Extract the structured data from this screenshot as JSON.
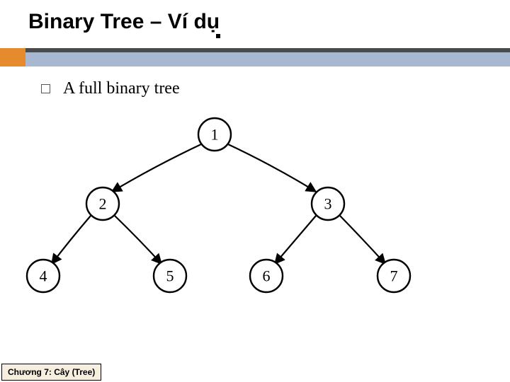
{
  "title": "Binary Tree – Ví dụ",
  "bullet": "A full binary tree",
  "footer": "Chương 7: Cây (Tree)",
  "tree": {
    "n1": "1",
    "n2": "2",
    "n3": "3",
    "n4": "4",
    "n5": "5",
    "n6": "6",
    "n7": "7"
  },
  "chart_data": {
    "type": "tree",
    "title": "A full binary tree",
    "nodes": [
      1,
      2,
      3,
      4,
      5,
      6,
      7
    ],
    "edges": [
      [
        1,
        2
      ],
      [
        1,
        3
      ],
      [
        2,
        4
      ],
      [
        2,
        5
      ],
      [
        3,
        6
      ],
      [
        3,
        7
      ]
    ],
    "root": 1
  }
}
